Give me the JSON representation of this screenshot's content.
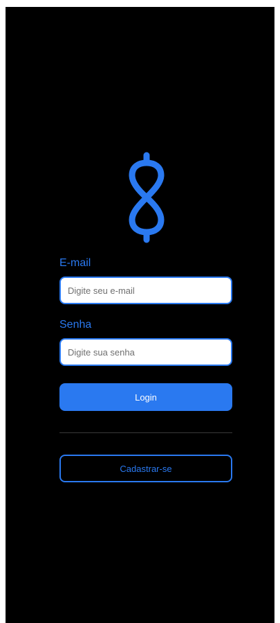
{
  "colors": {
    "accent": "#2a79f0",
    "background": "#000000",
    "input_background": "#ffffff",
    "divider": "#3a3a3a"
  },
  "logo": {
    "icon": "infinity-dollar-icon"
  },
  "email": {
    "label": "E-mail",
    "placeholder": "Digite seu e-mail",
    "value": ""
  },
  "password": {
    "label": "Senha",
    "placeholder": "Digite sua senha",
    "value": ""
  },
  "actions": {
    "login_label": "Login",
    "signup_label": "Cadastrar-se"
  }
}
